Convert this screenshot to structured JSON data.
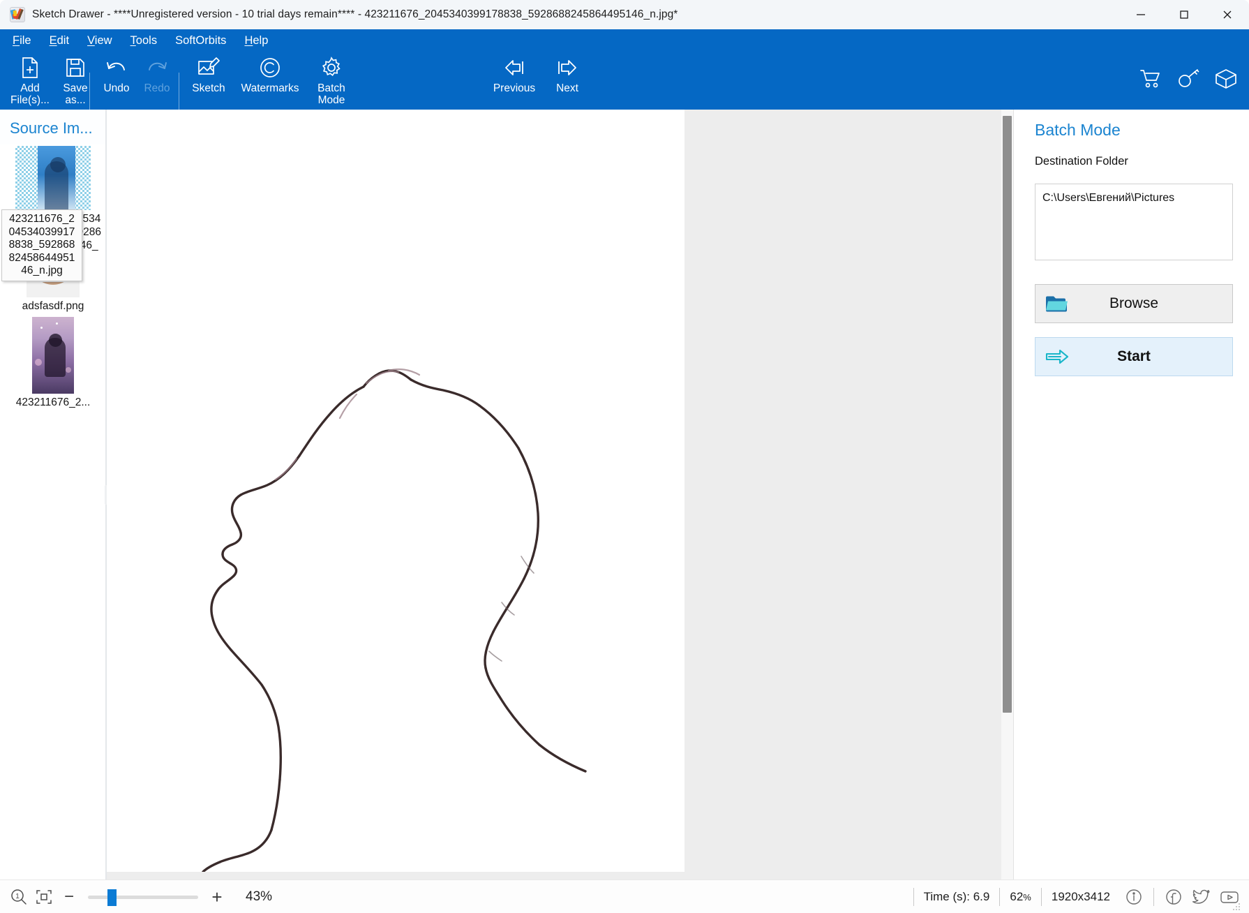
{
  "window": {
    "title": "Sketch Drawer - ****Unregistered version - 10 trial days remain**** - 423211676_2045340399178838_5928688245864495146_n.jpg*",
    "app_icon": "palette-pencil-icon",
    "minimize_label": "–",
    "maximize_label": "□",
    "close_label": "✕"
  },
  "menubar": {
    "items": [
      {
        "label": "File",
        "accel": "F"
      },
      {
        "label": "Edit",
        "accel": "E"
      },
      {
        "label": "View",
        "accel": "V"
      },
      {
        "label": "Tools",
        "accel": "T"
      },
      {
        "label": "SoftOrbits",
        "accel": ""
      },
      {
        "label": "Help",
        "accel": "H"
      }
    ]
  },
  "toolbar": {
    "add_files_label": "Add\nFile(s)...",
    "save_as_label": "Save\nas...",
    "undo_label": "Undo",
    "redo_label": "Redo",
    "sketch_label": "Sketch",
    "watermarks_label": "Watermarks",
    "batch_mode_label": "Batch\nMode",
    "previous_label": "Previous",
    "next_label": "Next",
    "redo_disabled": true,
    "right_icons": [
      "cart-icon",
      "key-icon",
      "box-icon"
    ]
  },
  "sidebar": {
    "title": "Source Im...",
    "items": [
      {
        "name": "423211676_2045340399178838_5928688245864495146_n.jpg",
        "selected": true
      },
      {
        "name": "adsfasdf.png",
        "selected": false
      },
      {
        "name": "423211676_2...",
        "selected": false
      }
    ],
    "tooltip": "423211676_2045340399178838_5928688245864495146_n.jpg"
  },
  "right_panel": {
    "title": "Batch Mode",
    "destination_label": "Destination Folder",
    "destination_value": "C:\\Users\\Евгений\\Pictures",
    "browse_label": "Browse",
    "start_label": "Start",
    "browse_icon": "folder-open-icon",
    "start_icon": "arrow-right-icon"
  },
  "statusbar": {
    "zoom_reset_icon": "zoom-one-to-one-icon",
    "fit_screen_icon": "fit-to-screen-icon",
    "zoom_out_label": "−",
    "zoom_in_label": "+",
    "zoom_percent": "43%",
    "zoom_slider_value": 43,
    "time_label": "Time (s): 6.9",
    "quality_percent": "62",
    "quality_suffix": "%",
    "image_size": "1920x3412",
    "social_icons": [
      "info-icon",
      "facebook-icon",
      "twitter-icon",
      "youtube-icon"
    ]
  },
  "colors": {
    "ribbon_blue": "#0568c4",
    "accent_blue": "#1b84d0",
    "titlebar_bg": "#f3f6f9",
    "canvas_bg": "#ededed",
    "start_btn_bg": "#e4f1fb",
    "browse_btn_bg": "#efefef",
    "sketch_stroke": "#3a2b2b"
  }
}
